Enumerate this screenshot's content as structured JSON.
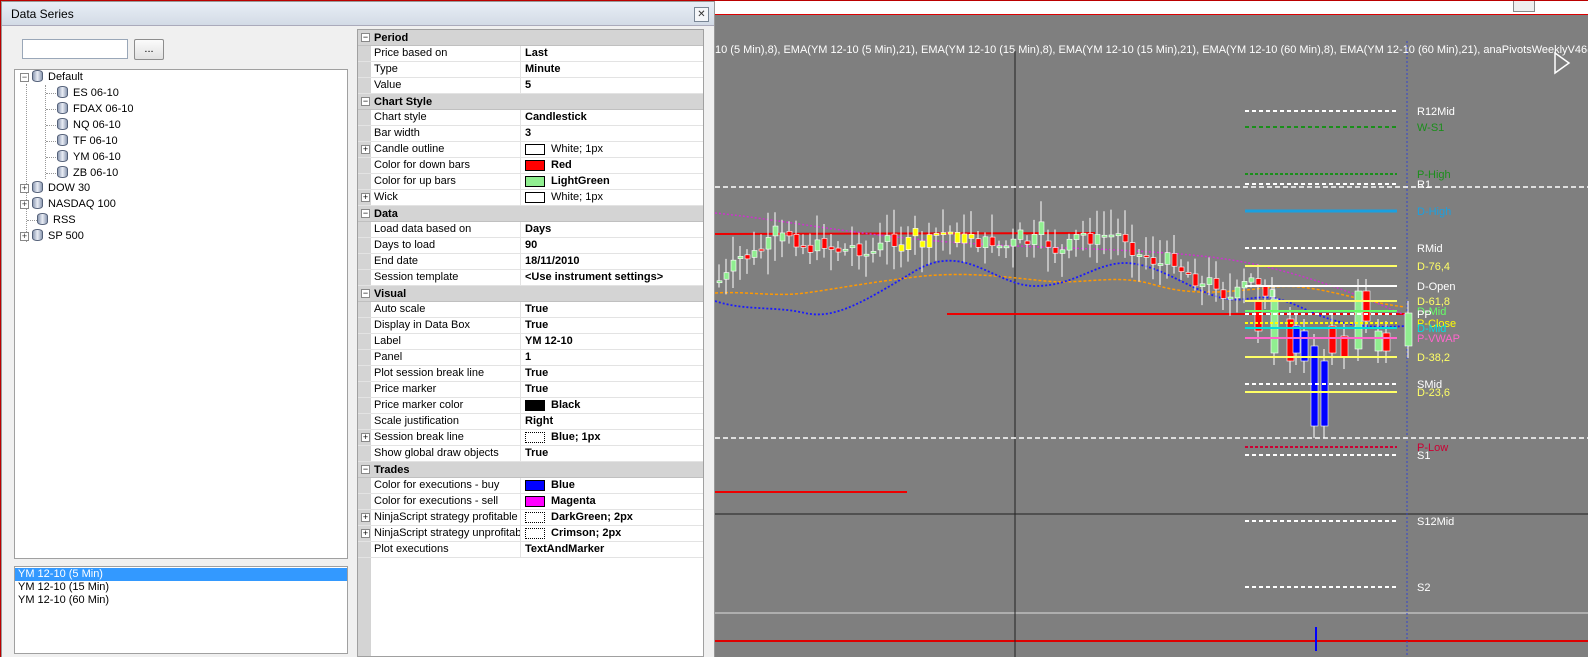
{
  "dialog": {
    "title": "Data Series",
    "close_glyph": "✕",
    "browse_label": "...",
    "search_value": ""
  },
  "tree": {
    "root_label": "Default",
    "children": [
      "ES 06-10",
      "FDAX 06-10",
      "NQ 06-10",
      "TF 06-10",
      "YM 06-10",
      "ZB 06-10"
    ],
    "groups": [
      "DOW 30",
      "NASDAQ 100",
      "RSS",
      "SP 500"
    ]
  },
  "series_list": [
    {
      "label": "YM 12-10 (5 Min)",
      "selected": true
    },
    {
      "label": "YM 12-10 (15 Min)",
      "selected": false
    },
    {
      "label": "YM 12-10 (60 Min)",
      "selected": false
    }
  ],
  "properties": {
    "period": {
      "category": "Period",
      "rows": [
        {
          "name": "Price based on",
          "value": "Last"
        },
        {
          "name": "Type",
          "value": "Minute"
        },
        {
          "name": "Value",
          "value": "5"
        }
      ]
    },
    "chart_style": {
      "category": "Chart Style",
      "rows": [
        {
          "name": "Chart style",
          "value": "Candlestick"
        },
        {
          "name": "Bar width",
          "value": "3"
        },
        {
          "name": "Candle outline",
          "value": "White; 1px",
          "swatch": "#ffffff"
        },
        {
          "name": "Color for down bars",
          "value": "Red",
          "swatch": "#ff0000"
        },
        {
          "name": "Color for up bars",
          "value": "LightGreen",
          "swatch": "#90ee90"
        },
        {
          "name": "Wick",
          "value": "White; 1px",
          "swatch": "#ffffff"
        }
      ]
    },
    "data": {
      "category": "Data",
      "rows": [
        {
          "name": "Load data based on",
          "value": "Days"
        },
        {
          "name": "Days to load",
          "value": "90"
        },
        {
          "name": "End date",
          "value": "18/11/2010"
        },
        {
          "name": "Session template",
          "value": "<Use instrument settings>"
        }
      ]
    },
    "visual": {
      "category": "Visual",
      "rows": [
        {
          "name": "Auto scale",
          "value": "True"
        },
        {
          "name": "Display in Data Box",
          "value": "True"
        },
        {
          "name": "Label",
          "value": "YM 12-10"
        },
        {
          "name": "Panel",
          "value": "1"
        },
        {
          "name": "Plot session break line",
          "value": "True"
        },
        {
          "name": "Price marker",
          "value": "True"
        },
        {
          "name": "Price marker color",
          "value": "Black",
          "swatch": "#000000"
        },
        {
          "name": "Scale justification",
          "value": "Right"
        },
        {
          "name": "Session break line",
          "value": "Blue; 1px",
          "swatch": "dotted"
        },
        {
          "name": "Show global draw objects",
          "value": "True"
        }
      ]
    },
    "trades": {
      "category": "Trades",
      "rows": [
        {
          "name": "Color for executions - buy",
          "value": "Blue",
          "swatch": "#0000ff"
        },
        {
          "name": "Color for executions - sell",
          "value": "Magenta",
          "swatch": "#ff00ff"
        },
        {
          "name": "NinjaScript strategy profitable",
          "value": "DarkGreen; 2px",
          "swatch": "dotted"
        },
        {
          "name": "NinjaScript strategy unprofitabl",
          "value": "Crimson; 2px",
          "swatch": "dotted"
        },
        {
          "name": "Plot executions",
          "value": "TextAndMarker"
        }
      ]
    },
    "plus_glyph": "+",
    "minus_glyph": "−"
  },
  "chart": {
    "indicator_line": "10 (5 Min),8), EMA(YM 12-10 (5 Min),21), EMA(YM 12-10 (15 Min),8), EMA(YM 12-10 (15 Min),21), EMA(YM 12-10 (60 Min),8), EMA(YM 12-10 (60 Min),21), anaPivotsWeeklyV46(",
    "pivot_labels": [
      {
        "text": "R12Mid",
        "color": "#ffffff"
      },
      {
        "text": "W-S1",
        "color": "#1a8f1a"
      },
      {
        "text": "P-High",
        "color": "#1a8f1a"
      },
      {
        "text": "R1",
        "color": "#ffffff"
      },
      {
        "text": "D-High",
        "color": "#1aa0e0"
      },
      {
        "text": "RMid",
        "color": "#ffffff"
      },
      {
        "text": "D-76,4",
        "color": "#ffff66"
      },
      {
        "text": "D-Open",
        "color": "#ffffff"
      },
      {
        "text": "D-61,8",
        "color": "#ffff66"
      },
      {
        "text": "D-Mid",
        "color": "#66ff66"
      },
      {
        "text": "PP",
        "color": "#ffffff"
      },
      {
        "text": "P-Close",
        "color": "#ffff00"
      },
      {
        "text": "D-Mid",
        "color": "#00e0e0"
      },
      {
        "text": "P-VWAP",
        "color": "#ff66cc"
      },
      {
        "text": "D-38,2",
        "color": "#ffff66"
      },
      {
        "text": "SMid",
        "color": "#ffffff"
      },
      {
        "text": "D-23,6",
        "color": "#ffff66"
      },
      {
        "text": "P-Low",
        "color": "#cc0033"
      },
      {
        "text": "S1",
        "color": "#ffffff"
      },
      {
        "text": "S12Mid",
        "color": "#ffffff"
      },
      {
        "text": "S2",
        "color": "#ffffff"
      }
    ],
    "colors": {
      "background": "#7f7f7f",
      "up": "#90ee90",
      "down": "#ff0000",
      "neutral": "#ffff00",
      "buy": "#0000ff"
    }
  }
}
